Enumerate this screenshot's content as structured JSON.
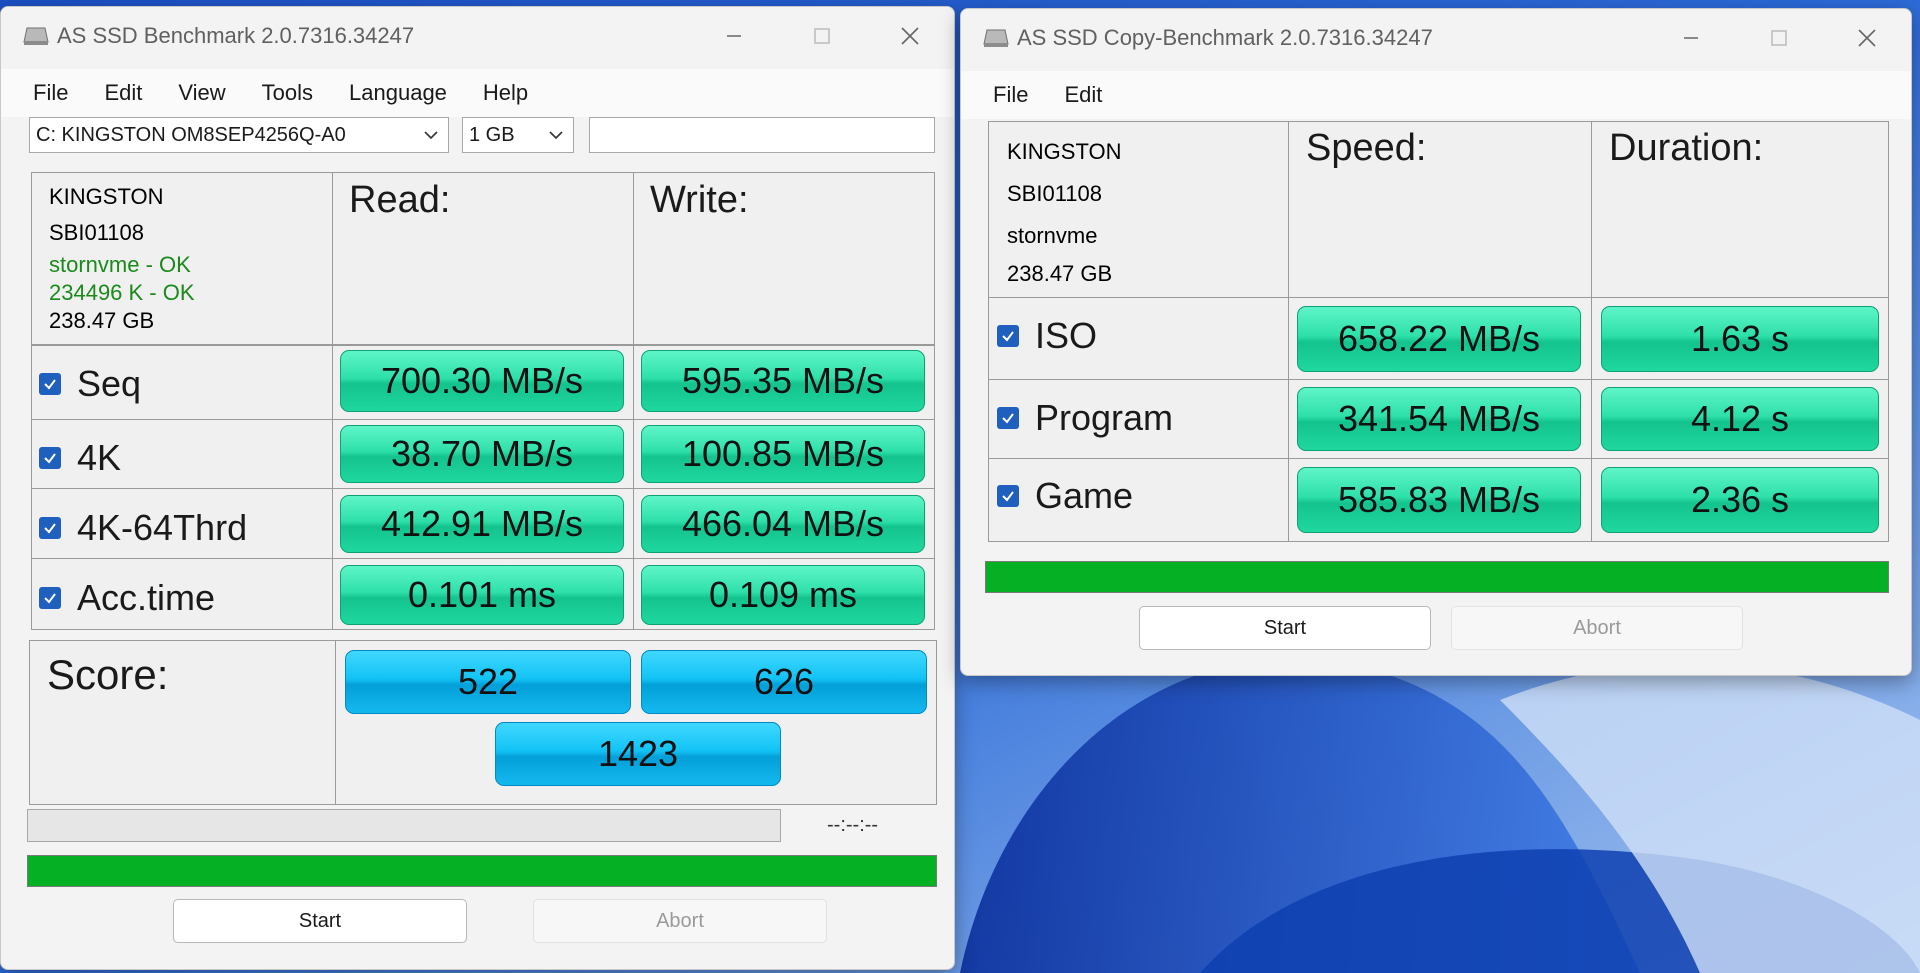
{
  "benchmark_window": {
    "title": "AS SSD Benchmark 2.0.7316.34247",
    "menu": [
      "File",
      "Edit",
      "View",
      "Tools",
      "Language",
      "Help"
    ],
    "drive_select": "C: KINGSTON OM8SEP4256Q-A0",
    "size_select": "1 GB",
    "drive_info": {
      "model": "KINGSTON",
      "firmware": "SBI01108",
      "driver": "stornvme - OK",
      "alignment": "234496 K - OK",
      "capacity": "238.47 GB"
    },
    "read_header": "Read:",
    "write_header": "Write:",
    "rows": [
      {
        "label": "Seq",
        "read": "700.30 MB/s",
        "write": "595.35 MB/s"
      },
      {
        "label": "4K",
        "read": "38.70 MB/s",
        "write": "100.85 MB/s"
      },
      {
        "label": "4K-64Thrd",
        "read": "412.91 MB/s",
        "write": "466.04 MB/s"
      },
      {
        "label": "Acc.time",
        "read": "0.101 ms",
        "write": "0.109 ms"
      }
    ],
    "score_label": "Score:",
    "score_read": "522",
    "score_write": "626",
    "score_total": "1423",
    "timer": "--:--:--",
    "start_label": "Start",
    "abort_label": "Abort"
  },
  "copy_window": {
    "title": "AS SSD Copy-Benchmark 2.0.7316.34247",
    "menu": [
      "File",
      "Edit"
    ],
    "drive_info": {
      "model": "KINGSTON",
      "firmware": "SBI01108",
      "driver": "stornvme",
      "capacity": "238.47 GB"
    },
    "speed_header": "Speed:",
    "duration_header": "Duration:",
    "rows": [
      {
        "label": "ISO",
        "speed": "658.22 MB/s",
        "duration": "1.63 s"
      },
      {
        "label": "Program",
        "speed": "341.54 MB/s",
        "duration": "4.12 s"
      },
      {
        "label": "Game",
        "speed": "585.83 MB/s",
        "duration": "2.36 s"
      }
    ],
    "start_label": "Start",
    "abort_label": "Abort"
  },
  "colors": {
    "value_green": "#2ee0aa",
    "score_blue": "#12c3f5",
    "progress_green": "#06b025",
    "checkbox_blue": "#1f5fbd",
    "ok_text": "#1a8a1a"
  },
  "icons": [
    "drive-icon",
    "minimize-icon",
    "maximize-icon",
    "close-icon",
    "chevron-down-icon",
    "checkbox-checked-icon"
  ]
}
